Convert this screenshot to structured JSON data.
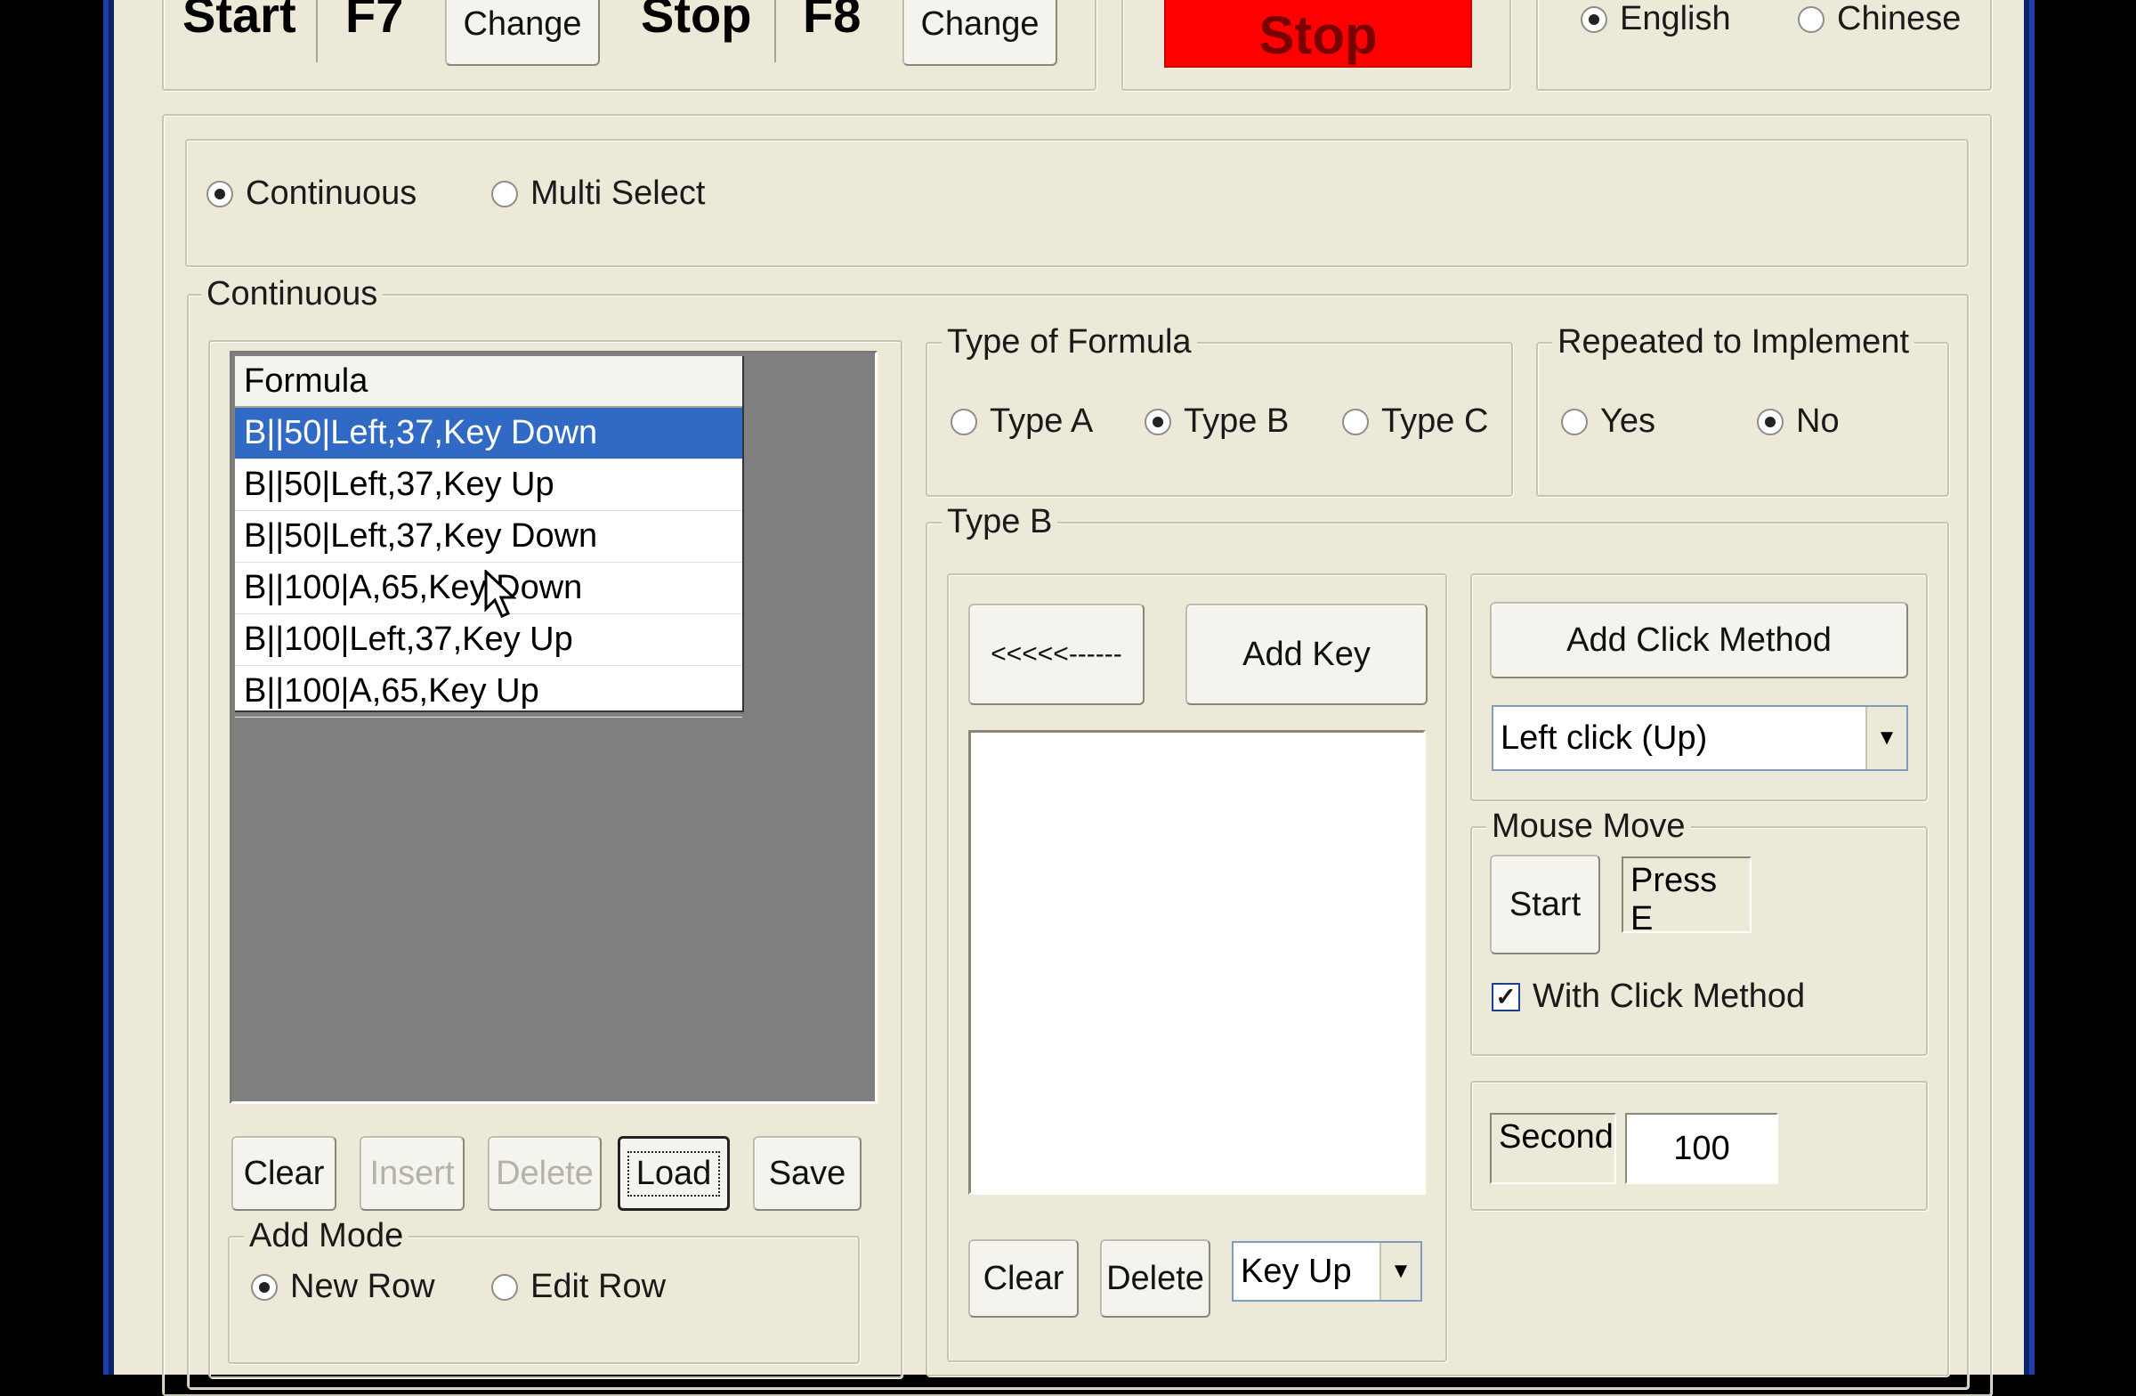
{
  "hotkeys": {
    "start_label": "Start",
    "start_key": "F7",
    "start_change": "Change",
    "stop_label": "Stop",
    "stop_key": "F8",
    "stop_change": "Change"
  },
  "stop_button": {
    "label": "Stop",
    "color": "#ff0000"
  },
  "language": {
    "options": [
      "English",
      "Chinese"
    ],
    "selected": "English"
  },
  "mode": {
    "options": [
      "Continuous",
      "Multi Select"
    ],
    "selected": "Continuous"
  },
  "continuous_group": {
    "title": "Continuous",
    "formula_header": "Formula",
    "formula_rows": [
      "B||50|Left,37,Key Down",
      "B||50|Left,37,Key Up",
      "B||50|Left,37,Key Down",
      "B||100|A,65,Key Down",
      "B||100|Left,37,Key Up",
      "B||100|A,65,Key Up"
    ],
    "selected_row": 0,
    "buttons": {
      "clear": "Clear",
      "insert": "Insert",
      "delete": "Delete",
      "load": "Load",
      "save": "Save"
    },
    "add_mode": {
      "title": "Add Mode",
      "options": [
        "New Row",
        "Edit Row"
      ],
      "selected": "New Row"
    }
  },
  "type_of_formula": {
    "title": "Type of Formula",
    "options": [
      "Type A",
      "Type B",
      "Type C"
    ],
    "selected": "Type B"
  },
  "repeated": {
    "title": "Repeated to Implement",
    "options": [
      "Yes",
      "No"
    ],
    "selected": "No"
  },
  "type_b": {
    "title": "Type B",
    "back_button": "<<<<<------",
    "add_key_button": "Add Key",
    "clear_button": "Clear",
    "delete_button": "Delete",
    "key_event_value": "Key Up",
    "add_click_method": "Add Click Method",
    "click_method_value": "Left click (Up)",
    "mouse_move": {
      "title": "Mouse Move",
      "start_button": "Start",
      "hint": "Press E",
      "with_click_label": "With Click Method",
      "with_click_checked": true
    },
    "second_label": "Second",
    "second_value": "100"
  },
  "colors": {
    "window_bg": "#ece9d8",
    "selection": "#316ac5",
    "accent_border": "#0a246a"
  }
}
